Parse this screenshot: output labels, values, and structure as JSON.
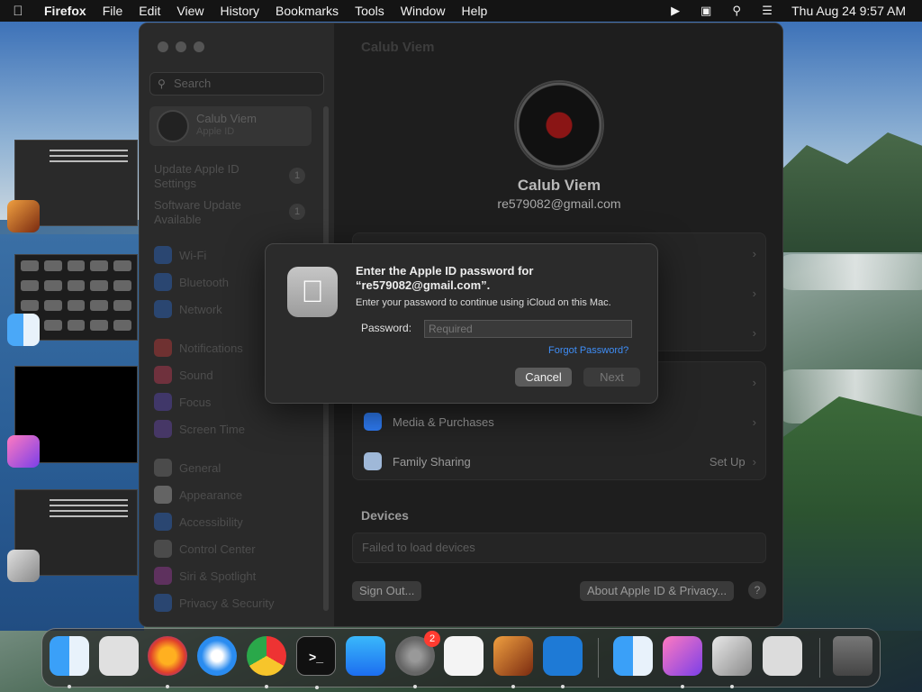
{
  "menubar": {
    "apple": "",
    "app": "Firefox",
    "items": [
      "File",
      "Edit",
      "View",
      "History",
      "Bookmarks",
      "Tools",
      "Window",
      "Help"
    ],
    "clock": "Thu Aug 24  9:57 AM"
  },
  "settings": {
    "search_placeholder": "Search",
    "account_name": "Calub Viem",
    "account_sub": "Apple ID",
    "notes": [
      {
        "label": "Update Apple ID Settings",
        "badge": "1"
      },
      {
        "label": "Software Update Available",
        "badge": "1"
      }
    ],
    "sidebar_items": [
      "Wi-Fi",
      "Bluetooth",
      "Network",
      "Notifications",
      "Sound",
      "Focus",
      "Screen Time",
      "General",
      "Appearance",
      "Accessibility",
      "Control Center",
      "Siri & Spotlight",
      "Privacy & Security"
    ],
    "main_title": "Calub Viem",
    "profile_name": "Calub Viem",
    "profile_email": "re579082@gmail.com",
    "rows": [
      {
        "label": "Media & Purchases",
        "value": ""
      },
      {
        "label": "Family Sharing",
        "value": "Set Up"
      }
    ],
    "devices_heading": "Devices",
    "devices_message": "Failed to load devices",
    "sign_out": "Sign Out...",
    "about": "About Apple ID & Privacy...",
    "help": "?"
  },
  "dialog": {
    "title": "Enter the Apple ID password for “re579082@gmail.com”.",
    "message": "Enter your password to continue using iCloud on this Mac.",
    "password_label": "Password:",
    "password_placeholder": "Required",
    "forgot": "Forgot Password?",
    "cancel": "Cancel",
    "next": "Next"
  },
  "dock": {
    "terminal_glyph": ">_",
    "settings_badge": "2"
  }
}
